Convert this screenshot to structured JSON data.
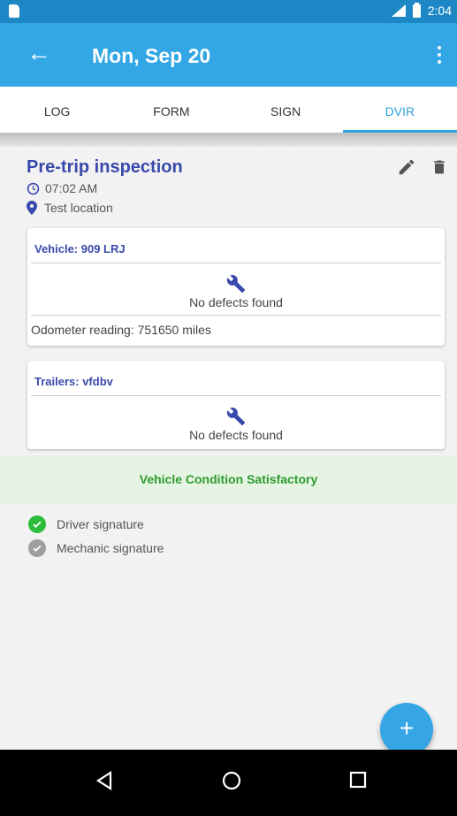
{
  "status_bar": {
    "time": "2:04"
  },
  "app_bar": {
    "title": "Mon, Sep 20"
  },
  "tabs": [
    {
      "label": "LOG",
      "active": false
    },
    {
      "label": "FORM",
      "active": false
    },
    {
      "label": "SIGN",
      "active": false
    },
    {
      "label": "DVIR",
      "active": true
    }
  ],
  "inspection": {
    "title": "Pre-trip inspection",
    "time": "07:02 AM",
    "location": "Test location"
  },
  "vehicle": {
    "header": "Vehicle: 909 LRJ",
    "defects": "No defects found",
    "odometer": "Odometer reading: 751650 miles"
  },
  "trailers": {
    "header": "Trailers: vfdbv",
    "defects": "No defects found"
  },
  "condition": "Vehicle Condition Satisfactory",
  "signatures": [
    {
      "label": "Driver signature",
      "signed": true
    },
    {
      "label": "Mechanic signature",
      "signed": false
    }
  ],
  "colors": {
    "primary": "#33a6e6",
    "status_bar": "#1e88c7",
    "title_blue": "#3949ab",
    "success_green": "#2ebd3a",
    "condition_bg": "#e5f4e3"
  }
}
